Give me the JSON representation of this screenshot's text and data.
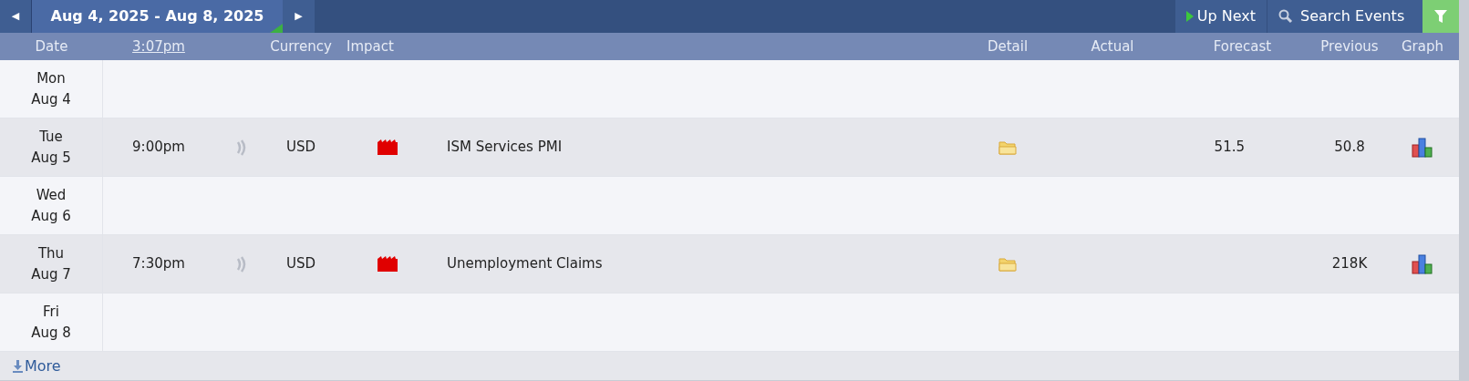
{
  "toolbar": {
    "prev": "◀",
    "range": "Aug 4, 2025 - Aug 8, 2025",
    "next": "▶",
    "up_next": "Up Next",
    "search": "Search Events"
  },
  "columns": [
    "Date",
    "3:07pm",
    "Currency",
    "Impact",
    "Detail",
    "Actual",
    "Forecast",
    "Previous",
    "Graph"
  ],
  "days": [
    {
      "day": "Mon",
      "date": "Aug 4"
    },
    {
      "day": "Tue",
      "date": "Aug 5",
      "events": [
        {
          "time": "9:00pm",
          "currency": "USD",
          "color": "#e00000",
          "title": "ISM Services PMI",
          "forecast": "51.5",
          "previous": "50.8"
        }
      ]
    },
    {
      "day": "Wed",
      "date": "Aug 6"
    },
    {
      "day": "Thu",
      "date": "Aug 7",
      "events": [
        {
          "time": "7:30pm",
          "currency": "USD",
          "color": "#e00000",
          "title": "Unemployment Claims",
          "previous": "218K"
        }
      ]
    },
    {
      "day": "Fri",
      "date": "Aug 8"
    }
  ],
  "more": "More"
}
